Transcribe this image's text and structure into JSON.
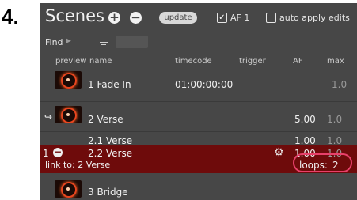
{
  "step_number": "4.",
  "header": {
    "title": "Scenes",
    "add_icon": "plus-circle-icon",
    "remove_icon": "minus-circle-icon",
    "update_label": "update",
    "af_checkbox": {
      "label": "AF 1",
      "checked": true
    },
    "auto_apply": {
      "label": "auto apply edits",
      "checked": false
    }
  },
  "toolbar": {
    "find_label": "Find",
    "find_arrow_icon": "triangle-right-icon",
    "filter_icon": "filter-lines-icon"
  },
  "columns": [
    "preview",
    "name",
    "timecode",
    "trigger",
    "AF",
    "max"
  ],
  "rows": [
    {
      "number": "",
      "name": "1 Fade In",
      "timecode": "01:00:00:00",
      "af": "",
      "max": "1.0"
    },
    {
      "number": "",
      "name": "2 Verse",
      "timecode": "",
      "af": "5.00",
      "max": "1.0",
      "link_icon": "link-arrow-icon"
    },
    {
      "number": "",
      "name": "2.1 Verse",
      "timecode": "",
      "af": "1.00",
      "max": "1.0"
    },
    {
      "number": "1",
      "name": "2.2 Verse",
      "timecode": "",
      "af": "1.00",
      "max": "1.0",
      "link_text": "link to: 2 Verse",
      "loops_label": "loops:",
      "loops_value": "2",
      "gear_icon": "gear-icon",
      "remove_icon": "minus-circle-icon"
    },
    {
      "number": "",
      "name": "3 Bridge",
      "timecode": "",
      "af": "",
      "max": ""
    }
  ],
  "colors": {
    "panel": "#474747",
    "highlight": "#6e0b0b",
    "annotation": "#e8406a",
    "preview_glow": "#e8461f"
  }
}
